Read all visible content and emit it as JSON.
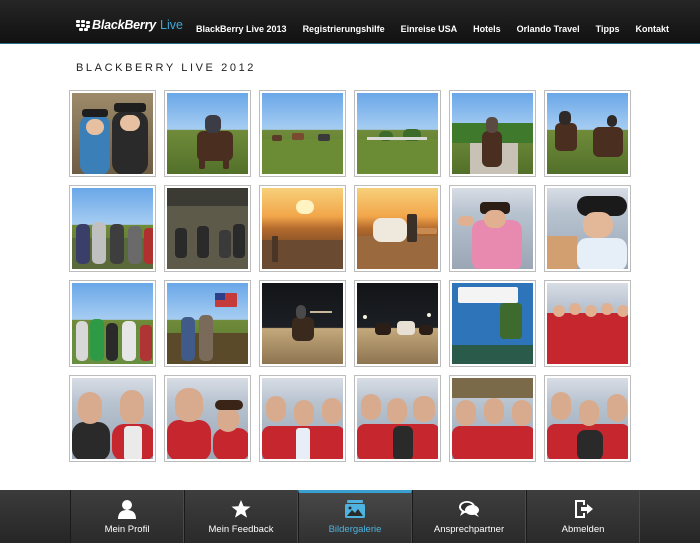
{
  "header": {
    "brand": "BlackBerry",
    "brand_suffix": "Live",
    "nav": [
      {
        "label": "BlackBerry Live 2013"
      },
      {
        "label": "Registrierungshilfe"
      },
      {
        "label": "Einreise USA"
      },
      {
        "label": "Hotels"
      },
      {
        "label": "Orlando Travel"
      },
      {
        "label": "Tipps"
      },
      {
        "label": "Kontakt"
      }
    ]
  },
  "page": {
    "title": "BLACKBERRY LIVE 2012"
  },
  "gallery": {
    "photos": [
      {
        "scene": "two-people-cowboy-hats-indoor"
      },
      {
        "scene": "rider-on-horse-trees"
      },
      {
        "scene": "horses-in-field-blue-sky"
      },
      {
        "scene": "horses-pasture-fence"
      },
      {
        "scene": "rider-on-horse-path"
      },
      {
        "scene": "riders-on-horses-sky"
      },
      {
        "scene": "group-people-outdoor-evening"
      },
      {
        "scene": "covered-arena-crowd"
      },
      {
        "scene": "sunset-over-arena"
      },
      {
        "scene": "horse-at-sunset"
      },
      {
        "scene": "man-cowboy-hat-pink-shirt"
      },
      {
        "scene": "man-cowboy-hat-glasses"
      },
      {
        "scene": "crowd-outdoor-evening"
      },
      {
        "scene": "people-with-us-flag"
      },
      {
        "scene": "night-rider-lasso"
      },
      {
        "scene": "night-arena-horses"
      },
      {
        "scene": "vodafone-beach-barbeque-banner"
      },
      {
        "scene": "group-hawaiian-shirts"
      },
      {
        "scene": "two-men-portrait"
      },
      {
        "scene": "man-and-woman-hawaiian-shirts"
      },
      {
        "scene": "group-hawaiian-shirts-2"
      },
      {
        "scene": "group-hawaiian-shirts-3"
      },
      {
        "scene": "group-hawaiian-shirts-4"
      },
      {
        "scene": "group-hawaiian-shirts-5"
      }
    ]
  },
  "bottom_nav": {
    "active": "Bildergalerie",
    "tabs": [
      {
        "label": "Mein Profil",
        "icon": "user-icon"
      },
      {
        "label": "Mein Feedback",
        "icon": "star-icon"
      },
      {
        "label": "Bildergalerie",
        "icon": "gallery-icon"
      },
      {
        "label": "Ansprechpartner",
        "icon": "chat-bubbles-icon"
      },
      {
        "label": "Abmelden",
        "icon": "logout-icon"
      }
    ]
  },
  "colors": {
    "header_bg": "#1b1b1b",
    "accent": "#3aa0d2",
    "bottom_bar_bg": "#303030"
  }
}
